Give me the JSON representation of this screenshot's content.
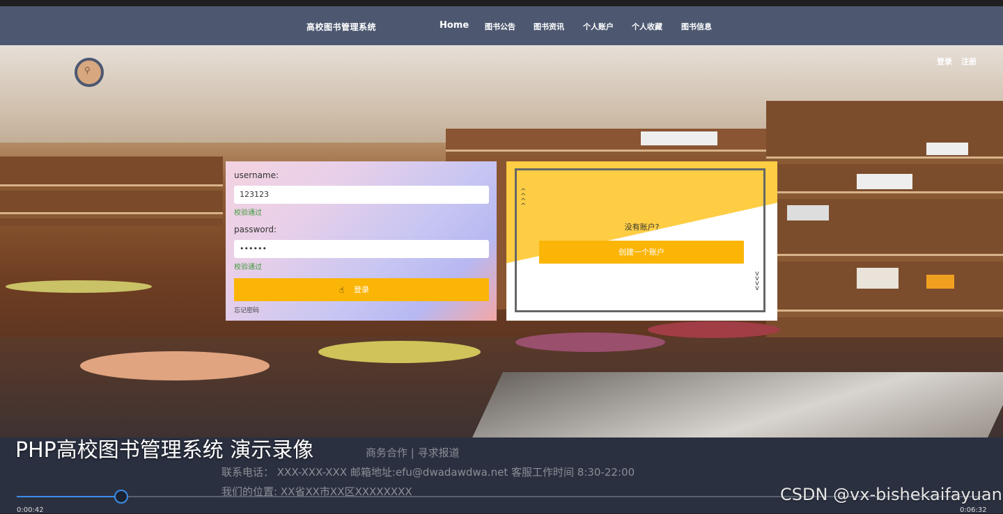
{
  "navbar": {
    "brand": "高校图书管理系统",
    "home": "Home",
    "items": [
      "图书公告",
      "图书资讯",
      "个人账户",
      "个人收藏",
      "图书信息"
    ]
  },
  "auth": {
    "login": "登录",
    "register": "注册"
  },
  "login_form": {
    "username_label": "username:",
    "username_value": "123123",
    "username_status": "校验通过",
    "password_label": "password:",
    "password_value": "••••••",
    "password_status": "校验通过",
    "login_button": "登录",
    "forgot": "忘记密码"
  },
  "signup_panel": {
    "title": "没有账户?",
    "create_button": "创建一个账户"
  },
  "footer": {
    "line1": "商务合作 | 寻求报道",
    "line2": "联系电话：  XXX-XXX-XXX 邮箱地址:efu@dwadawdwa.net 客服工作时间 8:30-22:00",
    "line3": "我们的位置: XX省XX市XX区XXXXXXXX"
  },
  "video": {
    "title": "PHP高校图书管理系统 演示录像",
    "current_time": "0:00:42",
    "total_time": "0:06:32",
    "progress": 0.107
  },
  "watermark": "CSDN @vx-bishekaifayuan",
  "colors": {
    "navbar": "#4d5870",
    "accent": "#fbb507",
    "signup_yellow": "#fecd44",
    "progress": "#3b8ee8"
  },
  "icons": {
    "search": "search-icon",
    "cursor": "pointer-cursor-icon"
  }
}
